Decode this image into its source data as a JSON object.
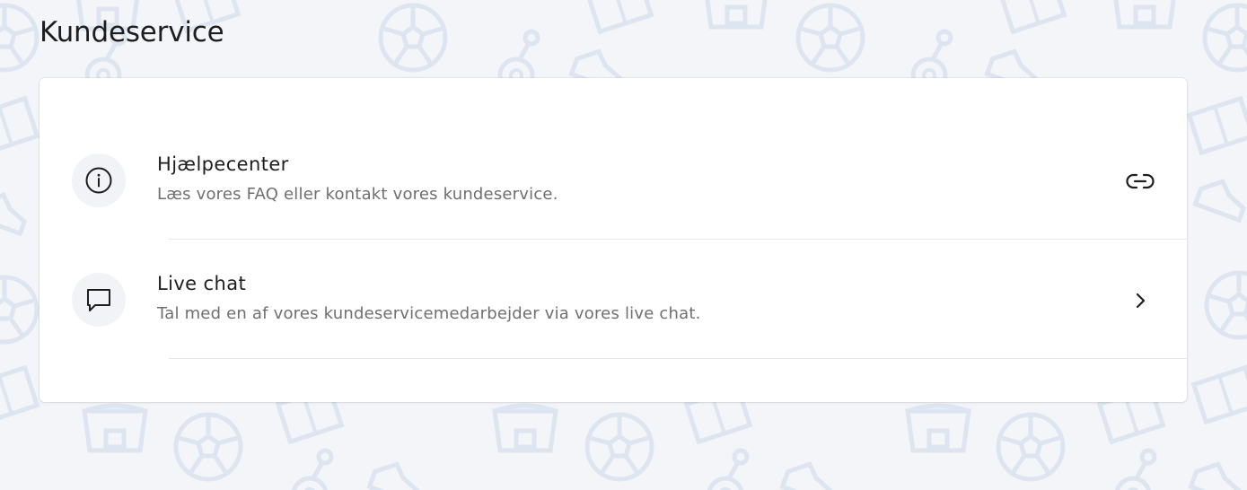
{
  "page": {
    "title": "Kundeservice"
  },
  "items": [
    {
      "title": "Hjælpecenter",
      "description": "Læs vores FAQ eller kontakt vores kundeservice.",
      "icon": "info-icon",
      "action_icon": "link-icon"
    },
    {
      "title": "Live chat",
      "description": "Tal med en af vores kundeservicemedarbejder via vores live chat.",
      "icon": "chat-icon",
      "action_icon": "chevron-right-icon"
    }
  ],
  "colors": {
    "background": "#f4f5f9",
    "pattern": "#dfe6f2",
    "card": "#ffffff",
    "title_text": "#1e1e1e",
    "secondary_text": "#6f6f6f",
    "icon_circle": "#f2f3f7"
  }
}
